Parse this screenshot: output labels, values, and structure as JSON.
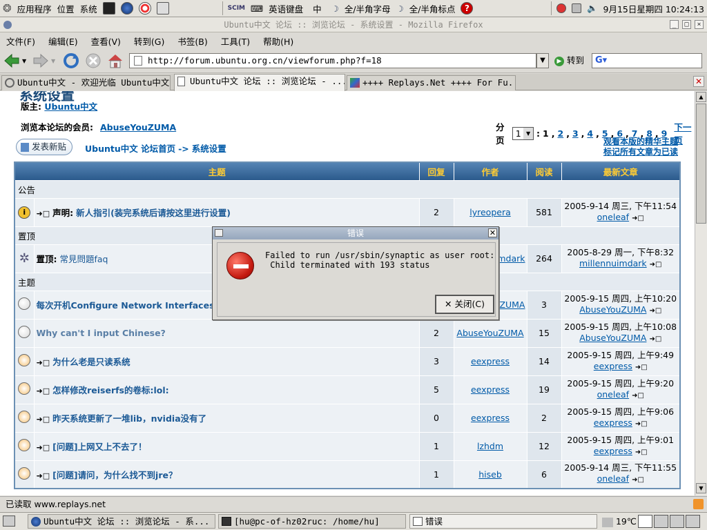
{
  "panel": {
    "apps_menu": "应用程序",
    "places_menu": "位置",
    "system_menu": "系统",
    "input_method": "英语键盘",
    "ime_mode": "中",
    "width_mode": "全/半角字母",
    "punct_mode": "全/半角标点",
    "scim_label": "SCIM",
    "datetime": "9月15日星期四  10:24:13"
  },
  "firefox": {
    "window_title": "Ubuntu中文 论坛 :: 浏览论坛 - 系统设置 - Mozilla Firefox",
    "menus": [
      "文件(F)",
      "编辑(E)",
      "查看(V)",
      "转到(G)",
      "书签(B)",
      "工具(T)",
      "帮助(H)"
    ],
    "url": "http://forum.ubuntu.org.cn/viewforum.php?f=18",
    "goto_label": "转到",
    "tabs": [
      "Ubuntu中文 - 欢迎光临 Ubuntu中文 ...",
      "Ubuntu中文 论坛 :: 浏览论坛 - ...",
      "++++ Replays.Net ++++ For Fu..."
    ],
    "status_text": "已读取 www.replays.net"
  },
  "forum": {
    "title": "系统设置",
    "moderator_label": "版主:",
    "moderator": "Ubuntu中文",
    "viewers_label": "浏览本论坛的会员:",
    "viewer": "AbuseYouZUMA",
    "page_label": "分页",
    "page_select": "1",
    "pages": [
      "1",
      "2",
      "3",
      "4",
      "5",
      "6",
      "7",
      "8",
      "9"
    ],
    "next_page": "下一页",
    "new_topic_button": "发表新贴",
    "breadcrumb_home": "Ubuntu中文 论坛首页",
    "breadcrumb_arrow": "->",
    "breadcrumb_current": "系统设置",
    "link_digest": "观看本版的精华主题",
    "link_mark_read": "标记所有文章为已读",
    "columns": [
      "主题",
      "回复",
      "作者",
      "阅读",
      "最新文章"
    ],
    "categories": {
      "announce": "公告",
      "sticky": "置顶",
      "topics": "主题"
    },
    "rows": [
      {
        "prefix": "声明:",
        "title": "新人指引(装完系统后请按这里进行设置)",
        "replies": "2",
        "author": "lyreopera",
        "views": "581",
        "last_time": "2005-9-14 周三, 下午11:54",
        "last_user": "oneleaf",
        "icon": "announce-icon"
      },
      {
        "prefix": "置顶:",
        "title": "常見問題faq",
        "replies": "",
        "author": "millennuimdark",
        "views": "264",
        "last_time": "2005-8-29 周一, 下午8:32",
        "last_user": "millennuimdark",
        "icon": "sticky-icon"
      },
      {
        "prefix": "",
        "title": "每次开机Configure Network Interfaces",
        "replies": "",
        "author": "AbuseYouZUMA",
        "views": "3",
        "last_time": "2005-9-15 周四, 上午10:20",
        "last_user": "AbuseYouZUMA",
        "icon": "topic-icon"
      },
      {
        "prefix": "",
        "title": "Why can't I input Chinese?",
        "replies": "2",
        "author": "AbuseYouZUMA",
        "views": "15",
        "last_time": "2005-9-15 周四, 上午10:08",
        "last_user": "AbuseYouZUMA",
        "icon": "topic-icon"
      },
      {
        "prefix": "",
        "title": "为什么老是只读系统",
        "replies": "3",
        "author": "eexpress",
        "views": "14",
        "last_time": "2005-9-15 周四, 上午9:49",
        "last_user": "eexpress",
        "icon": "topic-icon"
      },
      {
        "prefix": "",
        "title": "怎样修改reiserfs的卷标:lol:",
        "replies": "5",
        "author": "eexpress",
        "views": "19",
        "last_time": "2005-9-15 周四, 上午9:20",
        "last_user": "oneleaf",
        "icon": "topic-icon"
      },
      {
        "prefix": "",
        "title": "昨天系统更新了一堆lib，nvidia没有了",
        "replies": "0",
        "author": "eexpress",
        "views": "2",
        "last_time": "2005-9-15 周四, 上午9:06",
        "last_user": "eexpress",
        "icon": "topic-icon"
      },
      {
        "prefix": "",
        "title": "[问题]上网又上不去了！",
        "replies": "1",
        "author": "lzhdm",
        "views": "12",
        "last_time": "2005-9-15 周四, 上午9:01",
        "last_user": "eexpress",
        "icon": "topic-icon"
      },
      {
        "prefix": "",
        "title": "[问题]请问，为什么找不到jre？",
        "replies": "1",
        "author": "hiseb",
        "views": "6",
        "last_time": "2005-9-14 周三, 下午11:55",
        "last_user": "oneleaf",
        "icon": "topic-icon"
      }
    ]
  },
  "dialog": {
    "title": "错误",
    "message": "Failed to run /usr/sbin/synaptic as user root:\n Child terminated with 193 status",
    "close_button": "关闭(C)"
  },
  "taskbar": {
    "items": [
      "Ubuntu中文 论坛 :: 浏览论坛 - 系...",
      "[hu@pc-of-hz02ruc: /home/hu]",
      "错误"
    ],
    "temperature": "19℃"
  },
  "colors": {
    "header_bg": "#2b5a8c",
    "header_text": "#ffcc33",
    "link": "#005aa8"
  }
}
